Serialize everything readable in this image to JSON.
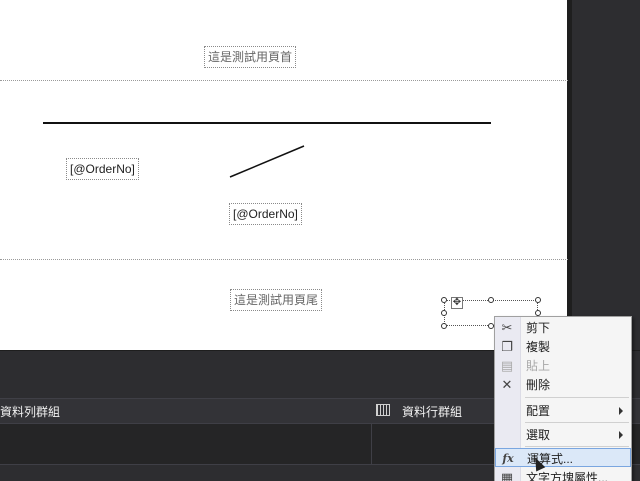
{
  "report": {
    "header_text": "這是測試用頁首",
    "field_orderno_1": "[@OrderNo]",
    "field_orderno_2": "[@OrderNo]",
    "footer_text": "這是測試用頁尾"
  },
  "grouping": {
    "row_groups_label": "資料列群組",
    "column_groups_label": "資料行群組"
  },
  "context_menu": {
    "items": [
      {
        "label": "剪下",
        "icon": "scissors-icon",
        "enabled": true
      },
      {
        "label": "複製",
        "icon": "copy-icon",
        "enabled": true
      },
      {
        "label": "貼上",
        "icon": "paste-icon",
        "enabled": false
      },
      {
        "label": "刪除",
        "icon": "delete-x-icon",
        "enabled": true
      },
      {
        "label": "配置",
        "submenu": true
      },
      {
        "label": "選取",
        "submenu": true
      },
      {
        "label": "運算式...",
        "icon": "fx-icon",
        "highlighted": true
      },
      {
        "label": "文字方塊屬性...",
        "icon": "properties-icon"
      }
    ]
  },
  "colors": {
    "canvas": "#ffffff",
    "dark_bg": "#2d2d30",
    "menu_highlight": "#dbe8f8"
  }
}
